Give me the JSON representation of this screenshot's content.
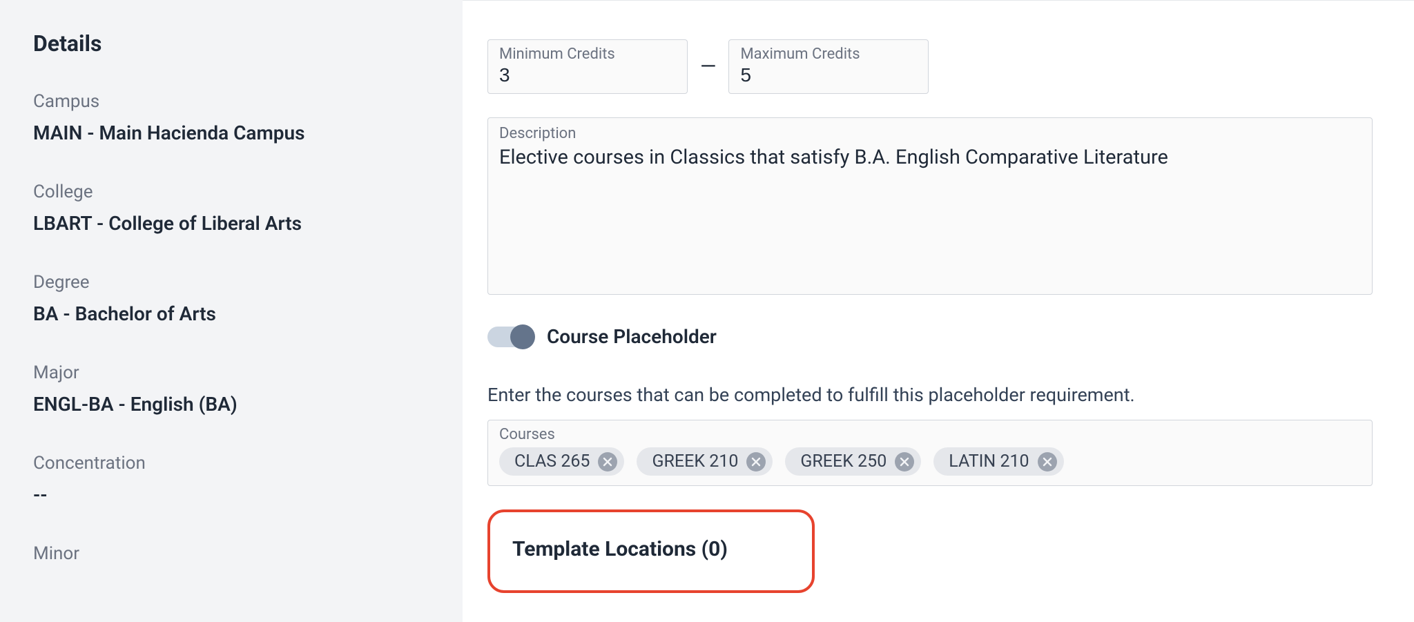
{
  "sidebar": {
    "heading": "Details",
    "groups": [
      {
        "label": "Campus",
        "value": "MAIN - Main Hacienda Campus"
      },
      {
        "label": "College",
        "value": "LBART - College of Liberal Arts"
      },
      {
        "label": "Degree",
        "value": "BA - Bachelor of Arts"
      },
      {
        "label": "Major",
        "value": "ENGL-BA - English (BA)"
      },
      {
        "label": "Concentration",
        "value": "--"
      },
      {
        "label": "Minor",
        "value": ""
      }
    ]
  },
  "credits": {
    "min_label": "Minimum Credits",
    "min_value": "3",
    "separator": "—",
    "max_label": "Maximum Credits",
    "max_value": "5"
  },
  "description": {
    "label": "Description",
    "value": "Elective courses in Classics that satisfy B.A. English Comparative Literature"
  },
  "toggle": {
    "label": "Course Placeholder",
    "on": true
  },
  "courses_helper": "Enter the courses that can be completed to fulfill this placeholder requirement.",
  "courses": {
    "label": "Courses",
    "chips": [
      "CLAS 265",
      "GREEK 210",
      "GREEK 250",
      "LATIN 210"
    ]
  },
  "template_locations": {
    "title": "Template Locations (0)"
  }
}
